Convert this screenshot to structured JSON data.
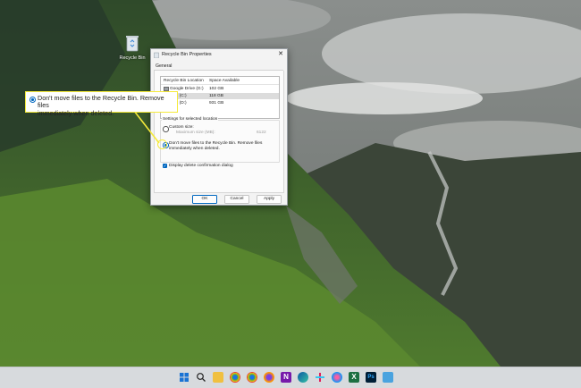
{
  "desktop": {
    "recycle_bin_label": "Recycle Bin"
  },
  "dialog": {
    "title": "Recycle Bin Properties",
    "close_glyph": "✕",
    "tab": "General",
    "columns": [
      "Recycle Bin Location",
      "Space Available"
    ],
    "rows": [
      {
        "location": "Google Drive (G:)",
        "space": "102 GB",
        "selected": false
      },
      {
        "location": "Disk (C:)",
        "space": "118 GB",
        "selected": true
      },
      {
        "location": "Disk (D:)",
        "space": "931 GB",
        "selected": false
      }
    ],
    "settings_label": "Settings for selected location",
    "custom_size_label": "Custom size:",
    "max_size_label": "Maximum size (MB):",
    "max_size_value": "6122",
    "dont_move_line1": "Don't move files to the Recycle Bin. Remove files",
    "dont_move_line2": "immediately when deleted.",
    "confirm_label": "Display delete confirmation dialog",
    "ok": "OK",
    "cancel": "Cancel",
    "apply": "Apply"
  },
  "callout": {
    "line1": "Don't move files to the Recycle Bin. Remove files",
    "line2": "immediately when deleted."
  },
  "colors": {
    "accent": "#0067c0",
    "highlight": "#f5ea3a",
    "taskbar": "#d7dadd"
  },
  "taskbar": {
    "icons": [
      "start-icon",
      "search-icon",
      "task-view-icon",
      "file-explorer-icon",
      "chrome-icon",
      "chrome-icon",
      "firefox-icon",
      "onenote-icon",
      "edge-icon",
      "slack-icon",
      "messenger-icon",
      "excel-icon",
      "photoshop-icon",
      "notepad-icon"
    ]
  }
}
